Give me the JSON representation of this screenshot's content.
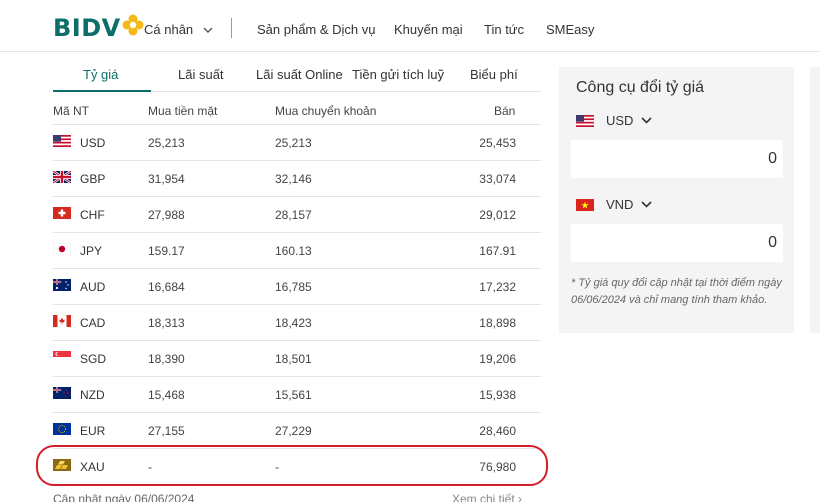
{
  "header": {
    "logo": "BIDV",
    "nav": [
      "Cá nhân",
      "Sản phẩm & Dịch vụ",
      "Khuyến mại",
      "Tin tức",
      "SMEasy"
    ]
  },
  "tabs": [
    "Tỷ giá",
    "Lãi suất",
    "Lãi suất Online",
    "Tiền gửi tích luỹ",
    "Biểu phí"
  ],
  "table": {
    "headers": [
      "Mã NT",
      "Mua tiền mặt",
      "Mua chuyển khoản",
      "Bán"
    ],
    "rows": [
      {
        "flag": "us-flag-icon",
        "code": "USD",
        "cash": "25,213",
        "transfer": "25,213",
        "sell": "25,453"
      },
      {
        "flag": "uk-flag-icon",
        "code": "GBP",
        "cash": "31,954",
        "transfer": "32,146",
        "sell": "33,074"
      },
      {
        "flag": "ch-flag-icon",
        "code": "CHF",
        "cash": "27,988",
        "transfer": "28,157",
        "sell": "29,012"
      },
      {
        "flag": "jp-flag-icon",
        "code": "JPY",
        "cash": "159.17",
        "transfer": "160.13",
        "sell": "167.91"
      },
      {
        "flag": "au-flag-icon",
        "code": "AUD",
        "cash": "16,684",
        "transfer": "16,785",
        "sell": "17,232"
      },
      {
        "flag": "ca-flag-icon",
        "code": "CAD",
        "cash": "18,313",
        "transfer": "18,423",
        "sell": "18,898"
      },
      {
        "flag": "sg-flag-icon",
        "code": "SGD",
        "cash": "18,390",
        "transfer": "18,501",
        "sell": "19,206"
      },
      {
        "flag": "nz-flag-icon",
        "code": "NZD",
        "cash": "15,468",
        "transfer": "15,561",
        "sell": "15,938"
      },
      {
        "flag": "eu-flag-icon",
        "code": "EUR",
        "cash": "27,155",
        "transfer": "27,229",
        "sell": "28,460"
      },
      {
        "flag": "gold-bar-icon",
        "code": "XAU",
        "cash": "-",
        "transfer": "-",
        "sell": "76,980"
      }
    ]
  },
  "footer": {
    "updated": "Cập nhật ngày 06/06/2024",
    "more": "Xem chi tiết"
  },
  "converter": {
    "title": "Công cụ đổi tỷ giá",
    "from_currency": "USD",
    "from_amount": "0",
    "to_currency": "VND",
    "to_amount": "0",
    "note": "* Tỷ giá quy đổi cập nhật tại thời điểm ngày 06/06/2024 và chỉ mang tính tham khảo."
  },
  "colors": {
    "brand": "#0c6e68",
    "accent": "#f5b916",
    "highlight": "#d31f2a"
  }
}
